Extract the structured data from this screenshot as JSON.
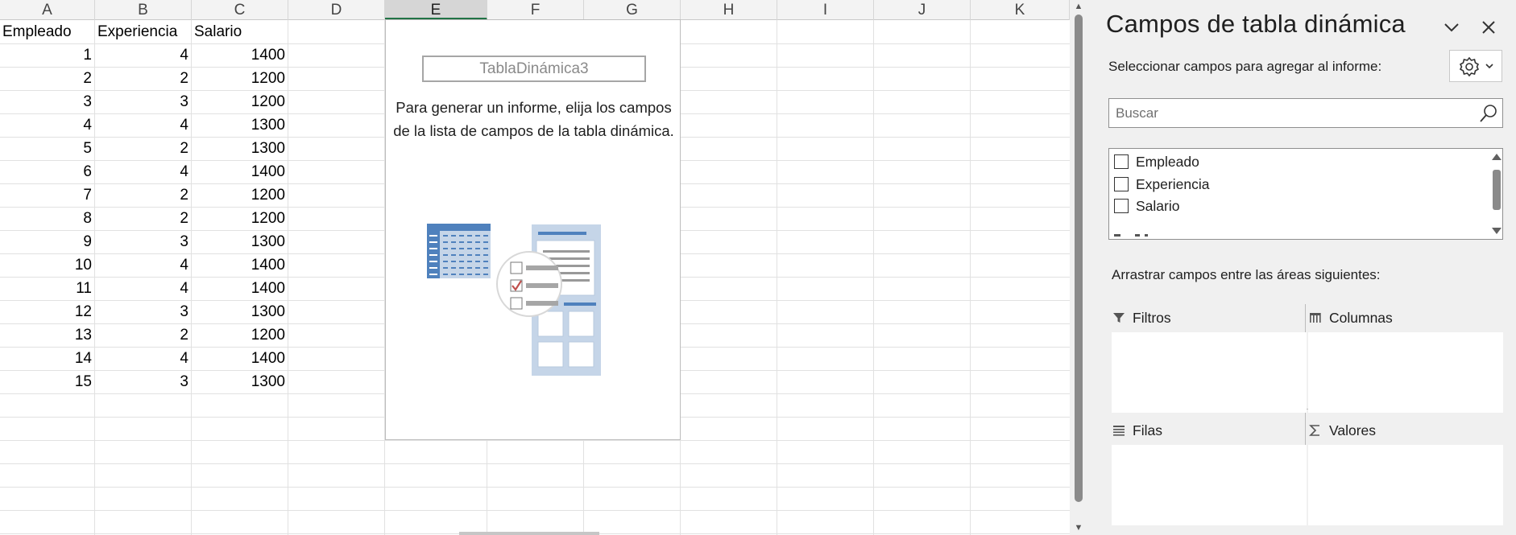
{
  "sheet": {
    "columns": [
      "A",
      "B",
      "C",
      "D",
      "E",
      "F",
      "G",
      "H",
      "I",
      "J",
      "K"
    ],
    "selected_column": "E",
    "headers": [
      "Empleado",
      "Experiencia",
      "Salario"
    ],
    "rows": [
      [
        "1",
        "4",
        "1400"
      ],
      [
        "2",
        "2",
        "1200"
      ],
      [
        "3",
        "3",
        "1200"
      ],
      [
        "4",
        "4",
        "1300"
      ],
      [
        "5",
        "2",
        "1300"
      ],
      [
        "6",
        "4",
        "1400"
      ],
      [
        "7",
        "2",
        "1200"
      ],
      [
        "8",
        "2",
        "1200"
      ],
      [
        "9",
        "3",
        "1300"
      ],
      [
        "10",
        "4",
        "1400"
      ],
      [
        "11",
        "4",
        "1400"
      ],
      [
        "12",
        "3",
        "1300"
      ],
      [
        "13",
        "2",
        "1200"
      ],
      [
        "14",
        "4",
        "1400"
      ],
      [
        "15",
        "3",
        "1300"
      ]
    ]
  },
  "pivot": {
    "name": "TablaDinámica3",
    "message": "Para generar un informe, elija los campos de la lista de campos de la tabla dinámica."
  },
  "pane": {
    "title": "Campos de tabla dinámica",
    "subtitle": "Seleccionar campos para agregar al informe:",
    "search_placeholder": "Buscar",
    "fields": [
      {
        "label": "Empleado",
        "checked": false
      },
      {
        "label": "Experiencia",
        "checked": false
      },
      {
        "label": "Salario",
        "checked": false
      }
    ],
    "drag_label": "Arrastrar campos entre las áreas siguientes:",
    "areas": {
      "filters": "Filtros",
      "columns": "Columnas",
      "rows": "Filas",
      "values": "Valores"
    }
  },
  "colors": {
    "accent_green": "#107c41",
    "illustration_blue": "#4f81bd",
    "illustration_light": "#c5d5e8",
    "check_red": "#c0504d"
  }
}
